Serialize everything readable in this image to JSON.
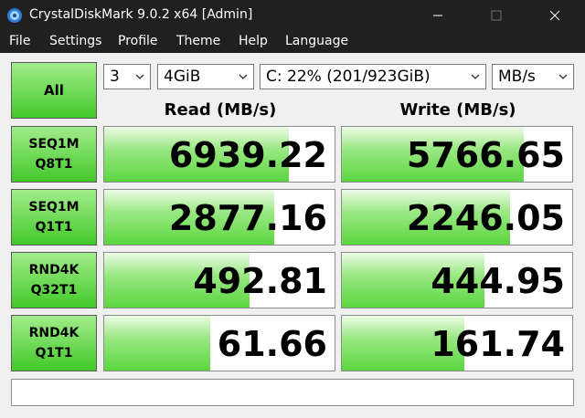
{
  "window": {
    "title": "CrystalDiskMark 9.0.2 x64 [Admin]"
  },
  "menu": [
    "File",
    "Settings",
    "Profile",
    "Theme",
    "Help",
    "Language"
  ],
  "controls": {
    "all_label": "All",
    "count": "3",
    "size": "4GiB",
    "drive": "C: 22% (201/923GiB)",
    "unit": "MB/s"
  },
  "headers": {
    "read": "Read (MB/s)",
    "write": "Write (MB/s)"
  },
  "tests": [
    {
      "line1": "SEQ1M",
      "line2": "Q8T1",
      "read": "6939.22",
      "write": "5766.65",
      "read_fill": 0.8,
      "write_fill": 0.79
    },
    {
      "line1": "SEQ1M",
      "line2": "Q1T1",
      "read": "2877.16",
      "write": "2246.05",
      "read_fill": 0.74,
      "write_fill": 0.73
    },
    {
      "line1": "RND4K",
      "line2": "Q32T1",
      "read": "492.81",
      "write": "444.95",
      "read_fill": 0.63,
      "write_fill": 0.62
    },
    {
      "line1": "RND4K",
      "line2": "Q1T1",
      "read": "61.66",
      "write": "161.74",
      "read_fill": 0.46,
      "write_fill": 0.53
    }
  ],
  "status_text": "",
  "colors": {
    "titlebar": "#202020",
    "accent_green": "#43c92a",
    "bar_green": "#5bd63f"
  },
  "icons": {
    "app": "crystal-disk-icon",
    "minimize": "minimize-icon",
    "maximize": "maximize-icon",
    "close": "close-icon",
    "dropdown": "chevron-down-icon"
  }
}
